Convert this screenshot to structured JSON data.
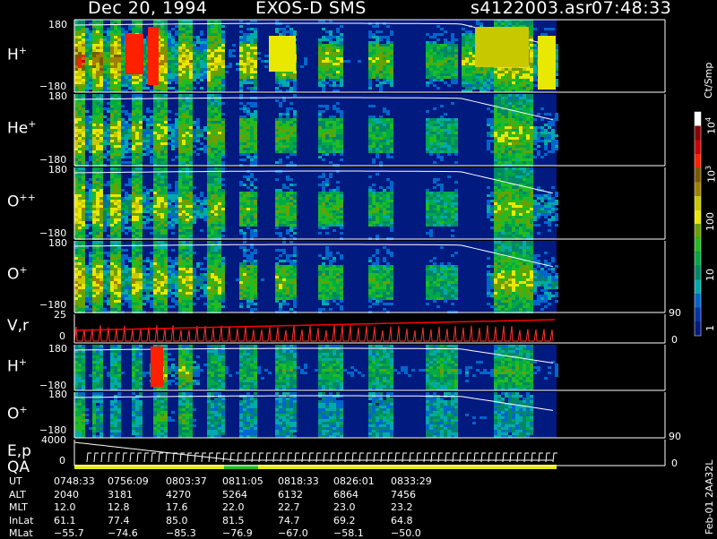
{
  "header": {
    "date": "Dec 20, 1994",
    "instrument": "EXOS-D SMS",
    "file": "s4122003.asr",
    "time": "07:48:33"
  },
  "panels": [
    {
      "name": "H",
      "charge": "+",
      "ymax": "180",
      "ymin": "−180"
    },
    {
      "name": "He",
      "charge": "+",
      "ymax": "180",
      "ymin": "−180"
    },
    {
      "name": "O",
      "charge": "++",
      "ymax": "180",
      "ymin": "−180"
    },
    {
      "name": "O",
      "charge": "+",
      "ymax": "180",
      "ymin": "−180"
    },
    {
      "name": "V,r",
      "charge": "",
      "ymax": "25",
      "ymin": "0",
      "right_top": "90",
      "right_bottom": "0"
    },
    {
      "name": "H",
      "charge": "+",
      "ymax": "180",
      "ymin": "−180"
    },
    {
      "name": "O",
      "charge": "+",
      "ymax": "180",
      "ymin": "−180"
    },
    {
      "name": "E,p",
      "charge": "",
      "ymax": "4000",
      "ymin": "0",
      "right_top": "90",
      "right_bottom": "0"
    }
  ],
  "qa_label": "QA",
  "colorbar": {
    "unit": "Ct/Smp",
    "labels": [
      "10^4",
      "10^3",
      "100",
      "10",
      "1"
    ],
    "colors": [
      "#ffffff",
      "#8b0000",
      "#cc0000",
      "#ff2000",
      "#7a5a00",
      "#a08000",
      "#c8c800",
      "#e8e800",
      "#6aa000",
      "#22bb22",
      "#00aa44",
      "#008866",
      "#00aaaa",
      "#0066cc",
      "#0033aa",
      "#001a80"
    ]
  },
  "side_note": "Feb-01 2AA32L",
  "footer": {
    "rows": [
      {
        "label": "UT",
        "values": [
          "0748:33",
          "0756:09",
          "0803:37",
          "0811:05",
          "0818:33",
          "0826:01",
          "0833:29"
        ]
      },
      {
        "label": "ALT",
        "values": [
          "2040",
          "3181",
          "4270",
          "5264",
          "6132",
          "6864",
          "7456"
        ]
      },
      {
        "label": "MLT",
        "values": [
          "12.0",
          "12.8",
          "17.6",
          "22.0",
          "22.7",
          "23.0",
          "23.2"
        ]
      },
      {
        "label": "InLat",
        "values": [
          "61.1",
          "77.4",
          "85.0",
          "81.5",
          "74.7",
          "69.2",
          "64.8"
        ]
      },
      {
        "label": "MLat",
        "values": [
          "−55.7",
          "−74.6",
          "−85.3",
          "−76.9",
          "−67.0",
          "−58.1",
          "−50.0"
        ]
      }
    ]
  },
  "chart_data": {
    "type": "heatmap",
    "title": "Dec 20, 1994   EXOS-D SMS",
    "x_label": "UT",
    "x_ticks": [
      "0748:33",
      "0756:09",
      "0803:37",
      "0811:05",
      "0818:33",
      "0826:01",
      "0833:29"
    ],
    "panels": [
      {
        "species": "H+",
        "y_range": [
          -180,
          180
        ]
      },
      {
        "species": "He+",
        "y_range": [
          -180,
          180
        ]
      },
      {
        "species": "O++",
        "y_range": [
          -180,
          180
        ]
      },
      {
        "species": "O+",
        "y_range": [
          -180,
          180
        ]
      },
      {
        "species": "V,r",
        "y_range": [
          0,
          25
        ],
        "right_range": [
          0,
          90
        ]
      },
      {
        "species": "H+",
        "y_range": [
          -180,
          180
        ]
      },
      {
        "species": "O+",
        "y_range": [
          -180,
          180
        ]
      },
      {
        "species": "E,p",
        "y_range": [
          0,
          4000
        ],
        "right_range": [
          0,
          90
        ]
      }
    ],
    "color_scale": {
      "unit": "Ct/Smp",
      "range": [
        1,
        10000
      ],
      "log": true
    }
  }
}
